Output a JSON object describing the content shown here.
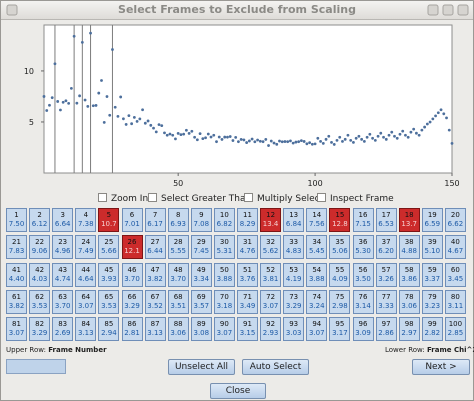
{
  "window": {
    "title": "Select Frames to Exclude from Scaling"
  },
  "colors": {
    "cell_normal": "#c6d9ee",
    "cell_selected": "#cc2b2b",
    "point": "#4d6f9c",
    "vline": "#7c7c7c"
  },
  "options": {
    "zoom": "Zoom In",
    "select_greater": "Select Greater Than",
    "multiply_select": "Multiply Select",
    "inspect_frame": "Inspect Frame"
  },
  "frames": [
    {
      "n": "1",
      "v": "7.50",
      "sel": false
    },
    {
      "n": "2",
      "v": "6.12",
      "sel": false
    },
    {
      "n": "3",
      "v": "6.64",
      "sel": false
    },
    {
      "n": "4",
      "v": "7.38",
      "sel": false
    },
    {
      "n": "5",
      "v": "10.7",
      "sel": true
    },
    {
      "n": "6",
      "v": "7.01",
      "sel": false
    },
    {
      "n": "7",
      "v": "6.17",
      "sel": false
    },
    {
      "n": "8",
      "v": "6.93",
      "sel": false
    },
    {
      "n": "9",
      "v": "7.08",
      "sel": false
    },
    {
      "n": "10",
      "v": "6.82",
      "sel": false
    },
    {
      "n": "11",
      "v": "8.29",
      "sel": false
    },
    {
      "n": "12",
      "v": "13.4",
      "sel": true
    },
    {
      "n": "13",
      "v": "6.84",
      "sel": false
    },
    {
      "n": "14",
      "v": "7.56",
      "sel": false
    },
    {
      "n": "15",
      "v": "12.8",
      "sel": true
    },
    {
      "n": "16",
      "v": "7.15",
      "sel": false
    },
    {
      "n": "17",
      "v": "6.53",
      "sel": false
    },
    {
      "n": "18",
      "v": "13.7",
      "sel": true
    },
    {
      "n": "19",
      "v": "6.59",
      "sel": false
    },
    {
      "n": "20",
      "v": "6.62",
      "sel": false
    },
    {
      "n": "21",
      "v": "7.83",
      "sel": false
    },
    {
      "n": "22",
      "v": "9.06",
      "sel": false
    },
    {
      "n": "23",
      "v": "4.96",
      "sel": false
    },
    {
      "n": "24",
      "v": "7.49",
      "sel": false
    },
    {
      "n": "25",
      "v": "5.66",
      "sel": false
    },
    {
      "n": "26",
      "v": "12.1",
      "sel": true
    },
    {
      "n": "27",
      "v": "6.44",
      "sel": false
    },
    {
      "n": "28",
      "v": "5.55",
      "sel": false
    },
    {
      "n": "29",
      "v": "7.45",
      "sel": false
    },
    {
      "n": "30",
      "v": "5.31",
      "sel": false
    },
    {
      "n": "31",
      "v": "4.76",
      "sel": false
    },
    {
      "n": "32",
      "v": "5.62",
      "sel": false
    },
    {
      "n": "33",
      "v": "4.83",
      "sel": false
    },
    {
      "n": "34",
      "v": "5.45",
      "sel": false
    },
    {
      "n": "35",
      "v": "5.06",
      "sel": false
    },
    {
      "n": "36",
      "v": "5.30",
      "sel": false
    },
    {
      "n": "37",
      "v": "6.20",
      "sel": false
    },
    {
      "n": "38",
      "v": "4.88",
      "sel": false
    },
    {
      "n": "39",
      "v": "5.10",
      "sel": false
    },
    {
      "n": "40",
      "v": "4.67",
      "sel": false
    },
    {
      "n": "41",
      "v": "4.40",
      "sel": false
    },
    {
      "n": "42",
      "v": "4.03",
      "sel": false
    },
    {
      "n": "43",
      "v": "4.74",
      "sel": false
    },
    {
      "n": "44",
      "v": "4.64",
      "sel": false
    },
    {
      "n": "45",
      "v": "3.93",
      "sel": false
    },
    {
      "n": "46",
      "v": "3.70",
      "sel": false
    },
    {
      "n": "47",
      "v": "3.82",
      "sel": false
    },
    {
      "n": "48",
      "v": "3.70",
      "sel": false
    },
    {
      "n": "49",
      "v": "3.34",
      "sel": false
    },
    {
      "n": "50",
      "v": "3.88",
      "sel": false
    },
    {
      "n": "51",
      "v": "3.76",
      "sel": false
    },
    {
      "n": "52",
      "v": "3.81",
      "sel": false
    },
    {
      "n": "53",
      "v": "4.19",
      "sel": false
    },
    {
      "n": "54",
      "v": "3.88",
      "sel": false
    },
    {
      "n": "55",
      "v": "4.09",
      "sel": false
    },
    {
      "n": "56",
      "v": "3.50",
      "sel": false
    },
    {
      "n": "57",
      "v": "3.26",
      "sel": false
    },
    {
      "n": "58",
      "v": "3.86",
      "sel": false
    },
    {
      "n": "59",
      "v": "3.37",
      "sel": false
    },
    {
      "n": "60",
      "v": "3.45",
      "sel": false
    },
    {
      "n": "61",
      "v": "3.82",
      "sel": false
    },
    {
      "n": "62",
      "v": "3.53",
      "sel": false
    },
    {
      "n": "63",
      "v": "3.70",
      "sel": false
    },
    {
      "n": "64",
      "v": "3.07",
      "sel": false
    },
    {
      "n": "65",
      "v": "3.53",
      "sel": false
    },
    {
      "n": "66",
      "v": "3.29",
      "sel": false
    },
    {
      "n": "67",
      "v": "3.52",
      "sel": false
    },
    {
      "n": "68",
      "v": "3.51",
      "sel": false
    },
    {
      "n": "69",
      "v": "3.57",
      "sel": false
    },
    {
      "n": "70",
      "v": "3.18",
      "sel": false
    },
    {
      "n": "71",
      "v": "3.49",
      "sel": false
    },
    {
      "n": "72",
      "v": "3.07",
      "sel": false
    },
    {
      "n": "73",
      "v": "3.29",
      "sel": false
    },
    {
      "n": "74",
      "v": "3.24",
      "sel": false
    },
    {
      "n": "75",
      "v": "2.98",
      "sel": false
    },
    {
      "n": "76",
      "v": "3.14",
      "sel": false
    },
    {
      "n": "77",
      "v": "3.33",
      "sel": false
    },
    {
      "n": "78",
      "v": "3.06",
      "sel": false
    },
    {
      "n": "79",
      "v": "3.23",
      "sel": false
    },
    {
      "n": "80",
      "v": "3.11",
      "sel": false
    },
    {
      "n": "81",
      "v": "3.07",
      "sel": false
    },
    {
      "n": "82",
      "v": "3.29",
      "sel": false
    },
    {
      "n": "83",
      "v": "2.69",
      "sel": false
    },
    {
      "n": "84",
      "v": "3.13",
      "sel": false
    },
    {
      "n": "85",
      "v": "2.94",
      "sel": false
    },
    {
      "n": "86",
      "v": "2.81",
      "sel": false
    },
    {
      "n": "87",
      "v": "3.13",
      "sel": false
    },
    {
      "n": "88",
      "v": "3.06",
      "sel": false
    },
    {
      "n": "89",
      "v": "3.08",
      "sel": false
    },
    {
      "n": "90",
      "v": "3.07",
      "sel": false
    },
    {
      "n": "91",
      "v": "3.15",
      "sel": false
    },
    {
      "n": "92",
      "v": "2.93",
      "sel": false
    },
    {
      "n": "93",
      "v": "3.03",
      "sel": false
    },
    {
      "n": "94",
      "v": "3.07",
      "sel": false
    },
    {
      "n": "95",
      "v": "3.17",
      "sel": false
    },
    {
      "n": "96",
      "v": "3.09",
      "sel": false
    },
    {
      "n": "97",
      "v": "2.86",
      "sel": false
    },
    {
      "n": "98",
      "v": "2.97",
      "sel": false
    },
    {
      "n": "99",
      "v": "2.82",
      "sel": false
    },
    {
      "n": "100",
      "v": "2.85",
      "sel": false
    }
  ],
  "legend": {
    "upper_prefix": "Upper Row:",
    "upper_value": "Frame Number",
    "lower_prefix": "Lower Row:",
    "lower_value": "Frame Chi^2"
  },
  "buttons": {
    "unselect_all": "Unselect All",
    "auto_select": "Auto Select",
    "next": "Next >",
    "close": "Close"
  },
  "chart_data": {
    "type": "scatter",
    "x_ticks": [
      "50",
      "100",
      "150"
    ],
    "y_ticks": [
      "5",
      "10"
    ],
    "xlim": [
      1,
      150
    ],
    "ylim": [
      0,
      14.5
    ],
    "grid": false,
    "vlines_at_x": [
      5,
      12,
      15,
      18,
      26
    ],
    "x": [
      1,
      2,
      3,
      4,
      5,
      6,
      7,
      8,
      9,
      10,
      11,
      12,
      13,
      14,
      15,
      16,
      17,
      18,
      19,
      20,
      21,
      22,
      23,
      24,
      25,
      26,
      27,
      28,
      29,
      30,
      31,
      32,
      33,
      34,
      35,
      36,
      37,
      38,
      39,
      40,
      41,
      42,
      43,
      44,
      45,
      46,
      47,
      48,
      49,
      50,
      51,
      52,
      53,
      54,
      55,
      56,
      57,
      58,
      59,
      60,
      61,
      62,
      63,
      64,
      65,
      66,
      67,
      68,
      69,
      70,
      71,
      72,
      73,
      74,
      75,
      76,
      77,
      78,
      79,
      80,
      81,
      82,
      83,
      84,
      85,
      86,
      87,
      88,
      89,
      90,
      91,
      92,
      93,
      94,
      95,
      96,
      97,
      98,
      99,
      100,
      101,
      102,
      103,
      104,
      105,
      106,
      107,
      108,
      109,
      110,
      111,
      112,
      113,
      114,
      115,
      116,
      117,
      118,
      119,
      120,
      121,
      122,
      123,
      124,
      125,
      126,
      127,
      128,
      129,
      130,
      131,
      132,
      133,
      134,
      135,
      136,
      137,
      138,
      139,
      140,
      141,
      142,
      143,
      144,
      145,
      146,
      147,
      148,
      149,
      150
    ],
    "y": [
      7.5,
      6.12,
      6.64,
      7.38,
      10.7,
      7.01,
      6.17,
      6.93,
      7.08,
      6.82,
      8.29,
      13.4,
      6.84,
      7.56,
      12.8,
      7.15,
      6.53,
      13.7,
      6.59,
      6.62,
      7.83,
      9.06,
      4.96,
      7.49,
      5.66,
      12.1,
      6.44,
      5.55,
      7.45,
      5.31,
      4.76,
      5.62,
      4.83,
      5.45,
      5.06,
      5.3,
      6.2,
      4.88,
      5.1,
      4.67,
      4.4,
      4.03,
      4.74,
      4.64,
      3.93,
      3.7,
      3.82,
      3.7,
      3.34,
      3.88,
      3.76,
      3.81,
      4.19,
      3.88,
      4.09,
      3.5,
      3.26,
      3.86,
      3.37,
      3.45,
      3.82,
      3.53,
      3.7,
      3.07,
      3.53,
      3.29,
      3.52,
      3.51,
      3.57,
      3.18,
      3.49,
      3.07,
      3.29,
      3.24,
      2.98,
      3.14,
      3.33,
      3.06,
      3.23,
      3.11,
      3.07,
      3.29,
      2.69,
      3.13,
      2.94,
      2.81,
      3.13,
      3.06,
      3.08,
      3.07,
      3.15,
      2.93,
      3.03,
      3.07,
      3.17,
      3.09,
      2.86,
      2.97,
      2.82,
      2.85,
      3.4,
      3.1,
      2.9,
      3.3,
      3.6,
      3.0,
      2.8,
      3.2,
      3.5,
      3.1,
      3.3,
      3.7,
      3.2,
      3.0,
      3.4,
      3.6,
      3.3,
      3.1,
      3.5,
      3.8,
      3.4,
      3.2,
      3.6,
      3.9,
      3.5,
      3.3,
      3.7,
      4.0,
      3.6,
      3.4,
      3.8,
      4.1,
      3.7,
      3.5,
      4.0,
      4.3,
      3.9,
      3.7,
      4.2,
      4.5,
      4.8,
      5.0,
      5.3,
      5.6,
      5.9,
      6.2,
      5.8,
      5.4,
      4.2,
      2.9
    ]
  }
}
